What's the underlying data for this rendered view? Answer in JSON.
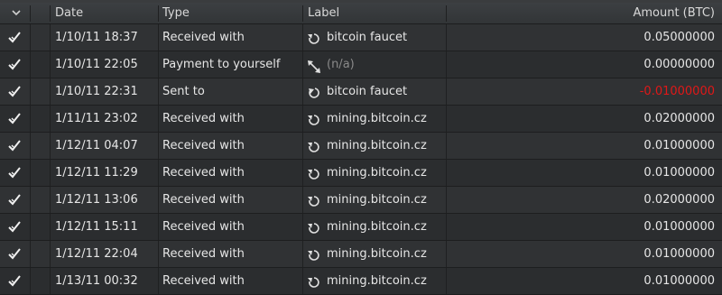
{
  "header": {
    "date": "Date",
    "type": "Type",
    "label": "Label",
    "amount": "Amount (BTC)",
    "corner_icon": "chevron-down-icon"
  },
  "colors": {
    "negative": "#e01818",
    "placeholder": "#8a8a8a"
  },
  "rows": [
    {
      "status_icon": "confirmed-check-icon",
      "date": "1/10/11 18:37",
      "type": "Received with",
      "type_icon": "received-icon",
      "label": "bitcoin faucet",
      "amount": "0.05000000",
      "negative": false
    },
    {
      "status_icon": "confirmed-check-icon",
      "date": "1/10/11 22:05",
      "type": "Payment to yourself",
      "type_icon": "payment-to-self-icon",
      "label": "(n/a)",
      "amount": "0.00000000",
      "negative": false
    },
    {
      "status_icon": "confirmed-check-icon",
      "date": "1/10/11 22:31",
      "type": "Sent to",
      "type_icon": "sent-icon",
      "label": "bitcoin faucet",
      "amount": "-0.01000000",
      "negative": true
    },
    {
      "status_icon": "confirmed-check-icon",
      "date": "1/11/11 23:02",
      "type": "Received with",
      "type_icon": "received-icon",
      "label": "mining.bitcoin.cz",
      "amount": "0.02000000",
      "negative": false
    },
    {
      "status_icon": "confirmed-check-icon",
      "date": "1/12/11 04:07",
      "type": "Received with",
      "type_icon": "received-icon",
      "label": "mining.bitcoin.cz",
      "amount": "0.01000000",
      "negative": false
    },
    {
      "status_icon": "confirmed-check-icon",
      "date": "1/12/11 11:29",
      "type": "Received with",
      "type_icon": "received-icon",
      "label": "mining.bitcoin.cz",
      "amount": "0.01000000",
      "negative": false
    },
    {
      "status_icon": "confirmed-check-icon",
      "date": "1/12/11 13:06",
      "type": "Received with",
      "type_icon": "received-icon",
      "label": "mining.bitcoin.cz",
      "amount": "0.02000000",
      "negative": false
    },
    {
      "status_icon": "confirmed-check-icon",
      "date": "1/12/11 15:11",
      "type": "Received with",
      "type_icon": "received-icon",
      "label": "mining.bitcoin.cz",
      "amount": "0.01000000",
      "negative": false
    },
    {
      "status_icon": "confirmed-check-icon",
      "date": "1/12/11 22:04",
      "type": "Received with",
      "type_icon": "received-icon",
      "label": "mining.bitcoin.cz",
      "amount": "0.01000000",
      "negative": false
    },
    {
      "status_icon": "confirmed-check-icon",
      "date": "1/13/11 00:32",
      "type": "Received with",
      "type_icon": "received-icon",
      "label": "mining.bitcoin.cz",
      "amount": "0.01000000",
      "negative": false
    }
  ]
}
